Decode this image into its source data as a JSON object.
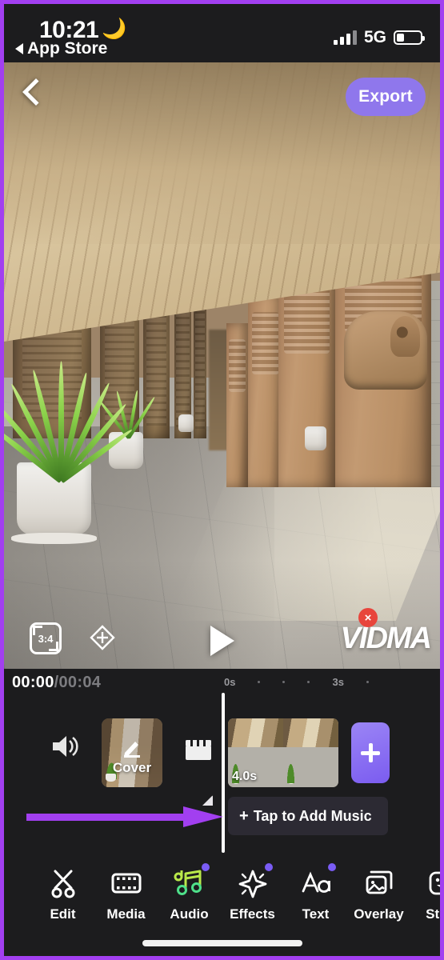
{
  "status_bar": {
    "time": "10:21",
    "moon_icon": "crescent-moon-icon",
    "back_label": "App Store",
    "signal_icon": "cellular-signal-icon",
    "network": "5G",
    "battery_icon": "battery-low-icon"
  },
  "preview": {
    "back_icon": "chevron-left-icon",
    "export_label": "Export",
    "aspect_ratio_label": "3:4",
    "aspect_ratio_icon": "crop-frame-icon",
    "move_icon": "move-diamond-icon",
    "play_icon": "play-triangle-icon",
    "watermark_text": "VIDMA",
    "watermark_close_icon": "close-x-icon",
    "watermark_close_label": "×",
    "scene_description": "stone temple corridor with carved pillars and potted plants"
  },
  "timeline": {
    "current_time": "00:00",
    "total_time": "/00:04",
    "ruler_ticks": [
      "0s",
      "·",
      "·",
      "·",
      "3s",
      "·"
    ],
    "speaker_icon": "volume-speaker-icon",
    "cover_label": "Cover",
    "cover_edit_icon": "pencil-edit-icon",
    "transition_icon": "clapperboard-icon",
    "clip_duration": "4.0s",
    "add_clip_icon": "plus-icon",
    "music_plus": "+",
    "music_label": "Tap to Add Music",
    "annotation_arrow": "purple-arrow-annotation"
  },
  "toolbar": {
    "items": [
      {
        "label": "Edit",
        "icon": "scissors-icon",
        "badge": false
      },
      {
        "label": "Media",
        "icon": "film-strip-icon",
        "badge": false
      },
      {
        "label": "Audio",
        "icon": "music-notes-icon",
        "badge": true
      },
      {
        "label": "Effects",
        "icon": "sparkle-icon",
        "badge": true
      },
      {
        "label": "Text",
        "icon": "text-aa-icon",
        "badge": true
      },
      {
        "label": "Overlay",
        "icon": "overlay-image-icon",
        "badge": false
      },
      {
        "label": "Stick",
        "icon": "sticker-smiley-icon",
        "badge": false
      }
    ]
  },
  "colors": {
    "accent_purple": "#7b5cf0",
    "export_purple": "#8f77ec",
    "frame_purple": "#a23ff0",
    "close_red": "#e8453c",
    "background": "#1c1c1e"
  }
}
